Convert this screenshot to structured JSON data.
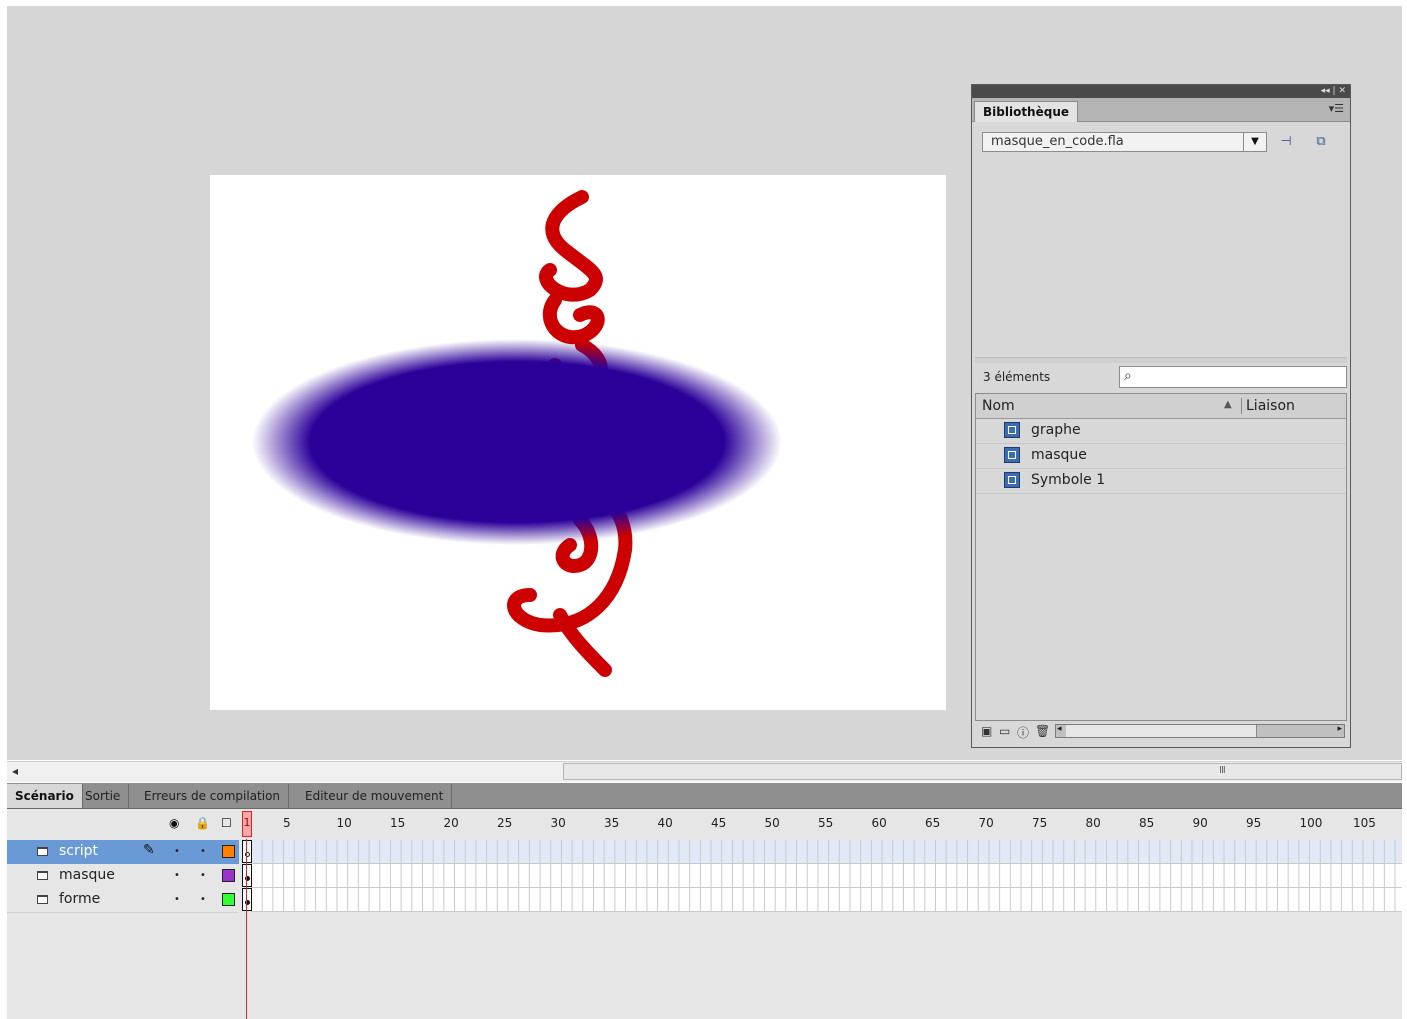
{
  "library": {
    "tab": "Bibliothèque",
    "file": "masque_en_code.fla",
    "count": "3 éléments",
    "col_name": "Nom",
    "col_link": "Liaison",
    "items": [
      "graphe",
      "masque",
      "Symbole 1"
    ],
    "titlebar_controls": "◂◂ | ✕"
  },
  "timeline": {
    "tabs": [
      "Scénario",
      "Sortie",
      "Erreurs de compilation",
      "Editeur de mouvement"
    ],
    "active_tab": "Scénario",
    "playhead_frame": "1",
    "frame_numbers": [
      "5",
      "10",
      "15",
      "20",
      "25",
      "30",
      "35",
      "40",
      "45",
      "50",
      "55",
      "60",
      "65",
      "70",
      "75",
      "80",
      "85",
      "90",
      "95",
      "100",
      "105"
    ],
    "layers": [
      {
        "name": "script",
        "selected": true,
        "color": "#ff7f00"
      },
      {
        "name": "masque",
        "selected": false,
        "color": "#9933cc"
      },
      {
        "name": "forme",
        "selected": false,
        "color": "#33ff33"
      }
    ]
  },
  "colors": {
    "ellipse": "#2b0099",
    "glyph": "#cc0000",
    "workspace": "#d6d6d6"
  },
  "icons": {
    "eye": "eye-icon",
    "lock": "lock-icon",
    "outline": "outline-icon",
    "pencil": "pencil-icon",
    "search": "search-icon",
    "symbol": "symbol-icon"
  }
}
